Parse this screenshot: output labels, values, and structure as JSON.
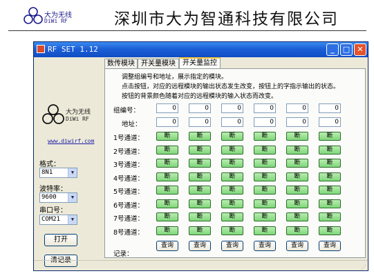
{
  "page_header": {
    "logo_cn": "大为无线",
    "logo_en": "DiWi RF",
    "company": "深圳市大为智通科技有限公司"
  },
  "window": {
    "title": "RF SET 1.12",
    "min_glyph": "_",
    "max_glyph": "□",
    "close_glyph": "✕"
  },
  "sidebar": {
    "logo_cn": "大为无线",
    "logo_en": "DiWi RF",
    "url": "www.diwirf.com",
    "format_label": "格式：",
    "format_value": "8N1",
    "baud_label": "波特率：",
    "baud_value": "9600",
    "port_label": "串口号：",
    "port_value": "COM21",
    "open_button": "打开",
    "clear_button": "清记录"
  },
  "tabs": [
    {
      "label": "数传模块"
    },
    {
      "label": "开关量模块"
    },
    {
      "label": "开关量监控"
    }
  ],
  "panel": {
    "desc": [
      "调整组编号和地址，展示指定的模块。",
      "点击按钮，对应的远程模块的输出状态发生改变，按钮上的字指示输出的状态。",
      "按钮的背景颜色随着对应的远程模块的输入状态而改变。"
    ],
    "group_label": "组编号：",
    "addr_label": "地址：",
    "group_values": [
      "0",
      "0",
      "0",
      "0",
      "0",
      "0"
    ],
    "addr_values": [
      "0",
      "0",
      "0",
      "0",
      "0",
      "0"
    ],
    "channels": [
      {
        "label": "1号通道：",
        "states": [
          "断",
          "断",
          "断",
          "断",
          "断",
          "断"
        ]
      },
      {
        "label": "2号通道：",
        "states": [
          "断",
          "断",
          "断",
          "断",
          "断",
          "断"
        ]
      },
      {
        "label": "3号通道：",
        "states": [
          "断",
          "断",
          "断",
          "断",
          "断",
          "断"
        ]
      },
      {
        "label": "4号通道：",
        "states": [
          "断",
          "断",
          "断",
          "断",
          "断",
          "断"
        ]
      },
      {
        "label": "5号通道：",
        "states": [
          "断",
          "断",
          "断",
          "断",
          "断",
          "断"
        ]
      },
      {
        "label": "6号通道：",
        "states": [
          "断",
          "断",
          "断",
          "断",
          "断",
          "断"
        ]
      },
      {
        "label": "7号通道：",
        "states": [
          "断",
          "断",
          "断",
          "断",
          "断",
          "断"
        ]
      },
      {
        "label": "8号通道：",
        "states": [
          "断",
          "断",
          "断",
          "断",
          "断",
          "断"
        ]
      }
    ],
    "query_label": "查询",
    "record_label": "记录："
  },
  "colors": {
    "channel_button": "#8fdc88",
    "title_bar": "#1c5fd6",
    "link": "#1a1aa8"
  }
}
